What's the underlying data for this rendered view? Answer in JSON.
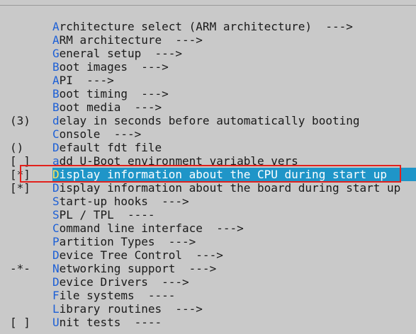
{
  "menu": {
    "items": [
      {
        "prefix": "",
        "hotkey": "A",
        "rest": "rchitecture select (ARM architecture)  --->"
      },
      {
        "prefix": "",
        "hotkey": "A",
        "rest": "RM architecture  --->"
      },
      {
        "prefix": "",
        "hotkey": "G",
        "rest": "eneral setup  --->"
      },
      {
        "prefix": "",
        "hotkey": "B",
        "rest": "oot images  --->"
      },
      {
        "prefix": "",
        "hotkey": "A",
        "rest": "PI  --->"
      },
      {
        "prefix": "",
        "hotkey": "B",
        "rest": "oot timing  --->"
      },
      {
        "prefix": "",
        "hotkey": "B",
        "rest": "oot media  --->"
      },
      {
        "prefix": "(3)",
        "hotkey": "d",
        "rest": "elay in seconds before automatically booting"
      },
      {
        "prefix": "",
        "hotkey": "C",
        "rest": "onsole  --->"
      },
      {
        "prefix": "()",
        "hotkey": "D",
        "rest": "efault fdt file"
      },
      {
        "prefix": "[ ]",
        "hotkey": "a",
        "rest": "dd U-Boot environment variable vers"
      },
      {
        "prefix": "[*]",
        "hotkey": "D",
        "rest": "isplay information about the CPU during start up"
      },
      {
        "prefix": "[*]",
        "hotkey": "D",
        "rest": "isplay information about the board during start up"
      },
      {
        "prefix": "",
        "hotkey": "S",
        "rest": "tart-up hooks  --->"
      },
      {
        "prefix": "",
        "hotkey": "S",
        "rest": "PL / TPL  ----"
      },
      {
        "prefix": "",
        "hotkey": "C",
        "rest": "ommand line interface  --->"
      },
      {
        "prefix": "",
        "hotkey": "P",
        "rest": "artition Types  --->"
      },
      {
        "prefix": "",
        "hotkey": "D",
        "rest": "evice Tree Control  --->"
      },
      {
        "prefix": "-*-",
        "hotkey": "N",
        "rest": "etworking support  --->"
      },
      {
        "prefix": "",
        "hotkey": "D",
        "rest": "evice Drivers  --->"
      },
      {
        "prefix": "",
        "hotkey": "F",
        "rest": "ile systems  ----"
      },
      {
        "prefix": "",
        "hotkey": "L",
        "rest": "ibrary routines  --->"
      },
      {
        "prefix": "[ ]",
        "hotkey": "U",
        "rest": "nit tests  ----"
      }
    ],
    "selected_index": 11
  },
  "colors": {
    "background": "#c9c9c9",
    "hotkey": "#1c5fd6",
    "selection": "#1f95c8",
    "selection_hotkey": "#ffe45a",
    "annotation_box": "#e2211c"
  }
}
